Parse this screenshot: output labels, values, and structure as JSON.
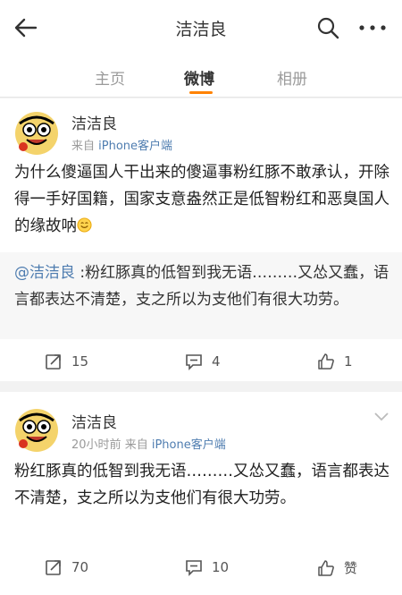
{
  "header": {
    "title": "洁洁良"
  },
  "tabs": [
    "主页",
    "微博",
    "相册"
  ],
  "posts": [
    {
      "name": "洁洁良",
      "meta_time": "",
      "meta_from": "来自",
      "source": "iPhone客户端",
      "text": "为什么傻逼国人干出来的傻逼事粉红豚不敢承认，开除得一手好国籍，国家支意盎然正是低智粉红和恶臭国人的缘故呐",
      "repost": {
        "mention": "@洁洁良",
        "text": " :粉红豚真的低智到我无语………又怂又蠢，语言都表达不清楚，支之所以为支他们有很大功劳。"
      },
      "actions": {
        "repost": "15",
        "comment": "4",
        "like": "1"
      }
    },
    {
      "name": "洁洁良",
      "meta_time": "20小时前",
      "meta_from": "来自",
      "source": "iPhone客户端",
      "text": "粉红豚真的低智到我无语………又怂又蠢，语言都表达不清楚，支之所以为支他们有很大功劳。",
      "actions": {
        "repost": "70",
        "comment": "10",
        "like": "赞"
      }
    }
  ],
  "colors": {
    "accent": "#ff8200",
    "link": "#4f7db0"
  }
}
